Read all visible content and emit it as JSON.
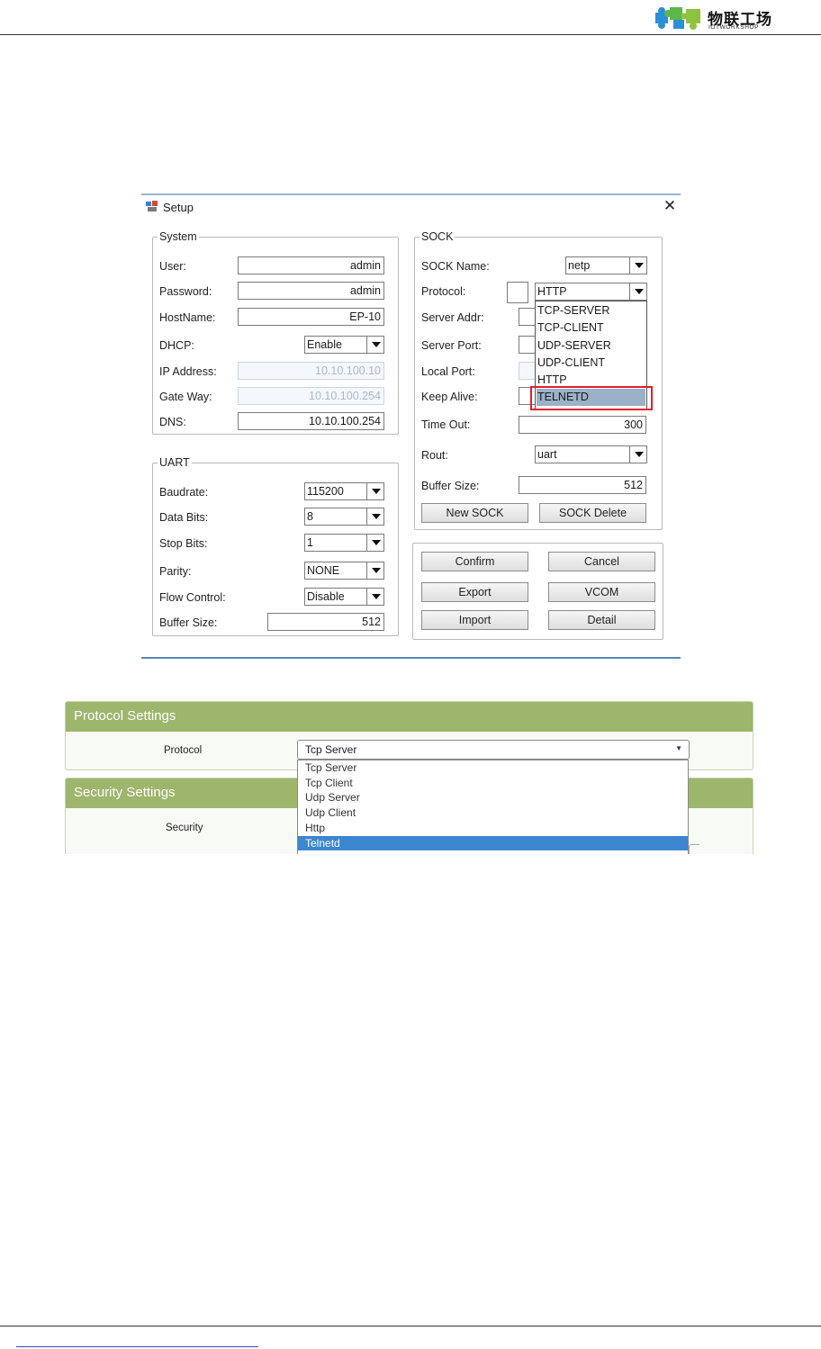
{
  "header": {
    "logo_cn": "物联工场",
    "logo_en": "IOTWORKSHOP"
  },
  "setup": {
    "title": "Setup",
    "close_glyph": "✕",
    "system": {
      "legend": "System",
      "user_label": "User:",
      "user_value": "admin",
      "password_label": "Password:",
      "password_value": "admin",
      "hostname_label": "HostName:",
      "hostname_value": "EP-10",
      "dhcp_label": "DHCP:",
      "dhcp_value": "Enable",
      "ip_label": "IP Address:",
      "ip_value": "10.10.100.10",
      "gateway_label": "Gate Way:",
      "gateway_value": "10.10.100.254",
      "dns_label": "DNS:",
      "dns_value": "10.10.100.254"
    },
    "uart": {
      "legend": "UART",
      "baudrate_label": "Baudrate:",
      "baudrate_value": "115200",
      "databits_label": "Data Bits:",
      "databits_value": "8",
      "stopbits_label": "Stop Bits:",
      "stopbits_value": "1",
      "parity_label": "Parity:",
      "parity_value": "NONE",
      "flow_label": "Flow Control:",
      "flow_value": "Disable",
      "buffer_label": "Buffer Size:",
      "buffer_value": "512"
    },
    "sock": {
      "legend": "SOCK",
      "name_label": "SOCK Name:",
      "name_value": "netp",
      "protocol_label": "Protocol:",
      "protocol_value": "HTTP",
      "server_addr_label": "Server Addr:",
      "server_port_label": "Server Port:",
      "local_port_label": "Local Port:",
      "keepalive_label": "Keep Alive:",
      "timeout_label": "Time Out:",
      "timeout_value": "300",
      "rout_label": "Rout:",
      "rout_value": "uart",
      "buffer_label": "Buffer Size:",
      "buffer_value": "512",
      "new_sock": "New SOCK",
      "sock_delete": "SOCK Delete",
      "protocol_options": [
        "TCP-SERVER",
        "TCP-CLIENT",
        "UDP-SERVER",
        "UDP-CLIENT",
        "HTTP",
        "TELNETD"
      ],
      "protocol_highlighted": "TELNETD"
    },
    "actions": {
      "confirm": "Confirm",
      "cancel": "Cancel",
      "export": "Export",
      "vcom": "VCOM",
      "import": "Import",
      "detail": "Detail"
    }
  },
  "web": {
    "protocol_panel": {
      "title": "Protocol Settings",
      "protocol_label": "Protocol",
      "selected": "Tcp Server",
      "options": [
        "Tcp Server",
        "Tcp Client",
        "Udp Server",
        "Udp Client",
        "Http",
        "Telnetd"
      ],
      "highlighted": "Telnetd"
    },
    "security_panel": {
      "title": "Security Settings",
      "security_label": "Security"
    }
  },
  "colors": {
    "panel_header": "#9eb56c",
    "list_highlight": "#3d86d0",
    "highlight_box": "#e0202a",
    "dialog_selection": "#9bb1c8"
  }
}
